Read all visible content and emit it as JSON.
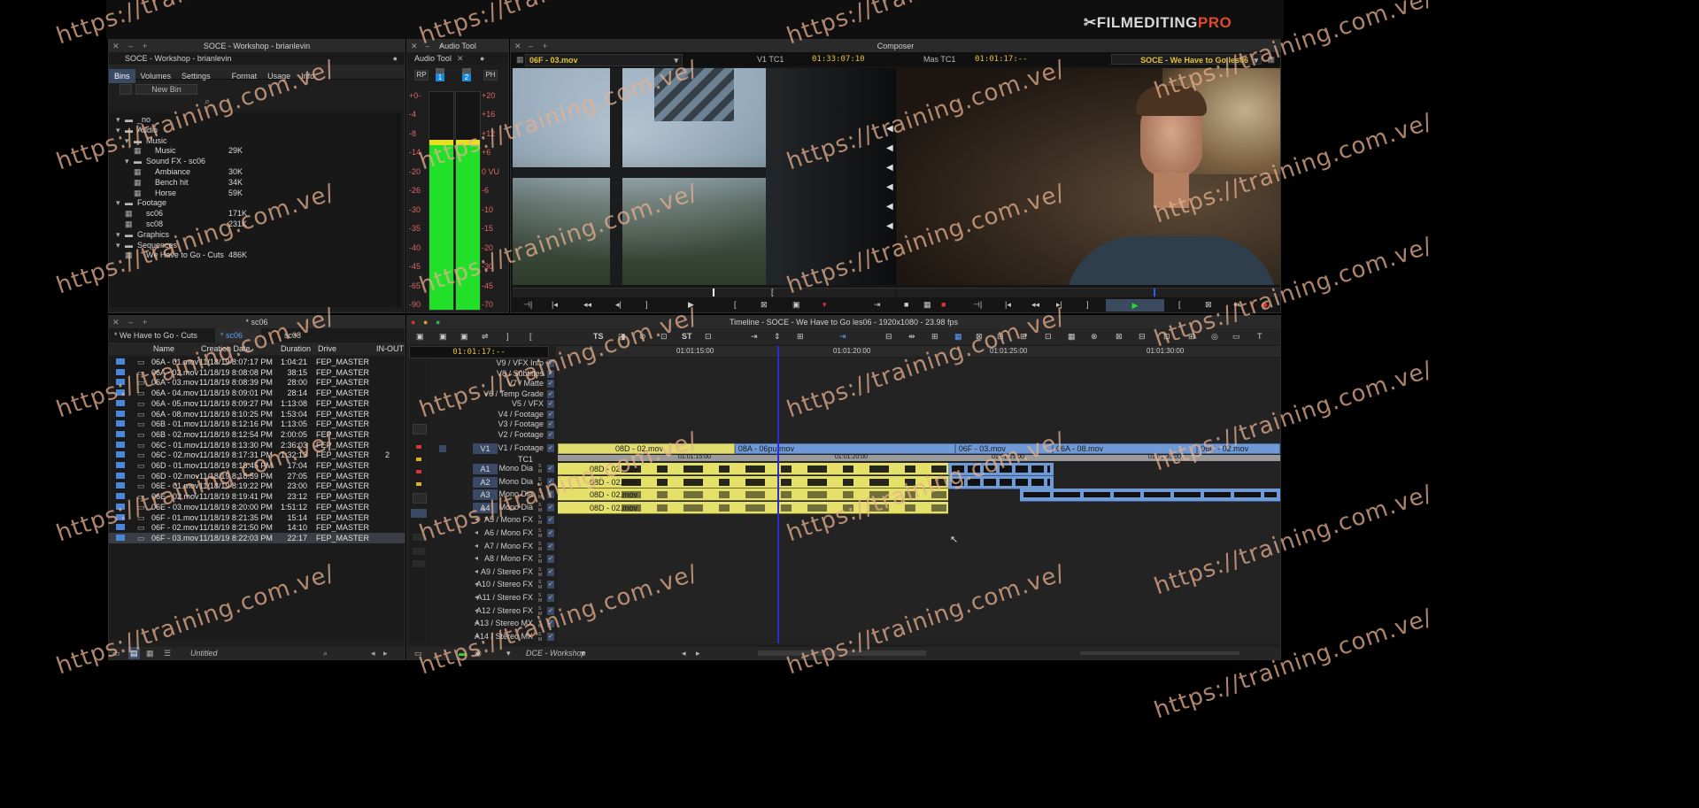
{
  "brand": {
    "logo_text": "FILMEDITING",
    "logo_accent": "PRO",
    "accent_color": "#e04a2a"
  },
  "project": {
    "title": "SOCE - Workshop - brianlevin",
    "subtitle": "SOCE - Workshop - brianlevin",
    "tabs": [
      "Bins",
      "Volumes",
      "Settings",
      "",
      "Format",
      "Usage",
      "Info"
    ],
    "new_bin_label": "New Bin",
    "tree": [
      {
        "label": "_no",
        "size": "",
        "indent": 0
      },
      {
        "label": "Audio",
        "size": "",
        "indent": 0
      },
      {
        "label": "Music",
        "size": "",
        "indent": 1
      },
      {
        "label": "Music",
        "size": "29K",
        "indent": 2
      },
      {
        "label": "Sound FX - sc06",
        "size": "",
        "indent": 1
      },
      {
        "label": "Ambiance",
        "size": "30K",
        "indent": 2
      },
      {
        "label": "Bench hit",
        "size": "34K",
        "indent": 2
      },
      {
        "label": "Horse",
        "size": "59K",
        "indent": 2
      },
      {
        "label": "Footage",
        "size": "",
        "indent": 0
      },
      {
        "label": "sc06",
        "size": "171K",
        "indent": 1
      },
      {
        "label": "sc08",
        "size": "231K",
        "indent": 1
      },
      {
        "label": "Graphics",
        "size": "",
        "indent": 0
      },
      {
        "label": "Sequences",
        "size": "",
        "indent": 0
      },
      {
        "label": "We Have to Go - Cuts",
        "size": "486K",
        "indent": 1
      }
    ]
  },
  "audio_tool": {
    "title": "Audio Tool",
    "tab": "Audio Tool",
    "rp_label": "RP",
    "ph_label": "PH",
    "ch1": "1",
    "ch2": "2",
    "left_scale": [
      "+0-",
      "-4",
      "-8",
      "-14",
      "-20",
      "-26",
      "-30",
      "-35",
      "-40",
      "-45",
      "-65",
      "-90"
    ],
    "right_scale": [
      "+20",
      "+16",
      "+12",
      "+6",
      "0 VU",
      "-6",
      "-10",
      "-15",
      "-20",
      "-30",
      "-45",
      "-70"
    ],
    "level_left": 0.78,
    "level_right": 0.78
  },
  "composer": {
    "title": "Composer",
    "source_clip": "06F - 03.mov",
    "v1_label": "V1  TC1",
    "v1_tc": "01:33:07:10",
    "mas_label": "Mas  TC1",
    "mas_tc": "01:01:17:--",
    "record_seq": "SOCE - We Have to Go les06"
  },
  "bin": {
    "title": "* sc06",
    "tabs": [
      "* We Have to Go - Cuts",
      "* sc06",
      "sc08"
    ],
    "columns": [
      "Name",
      "Creation Date",
      "Duration",
      "Drive",
      "IN-OUT"
    ],
    "rows": [
      {
        "name": "06A - 01.mov",
        "date": "11/18/19 8:07:17 PM",
        "dur": "1:04:21",
        "drive": "FEP_MASTER",
        "io": ""
      },
      {
        "name": "06A - 02.mov",
        "date": "11/18/19 8:08:08 PM",
        "dur": "38:15",
        "drive": "FEP_MASTER",
        "io": ""
      },
      {
        "name": "06A - 03.mov",
        "date": "11/18/19 8:08:39 PM",
        "dur": "28:00",
        "drive": "FEP_MASTER",
        "io": ""
      },
      {
        "name": "06A - 04.mov",
        "date": "11/18/19 8:09:01 PM",
        "dur": "28:14",
        "drive": "FEP_MASTER",
        "io": ""
      },
      {
        "name": "06A - 05.mov",
        "date": "11/18/19 8:09:27 PM",
        "dur": "1:13:08",
        "drive": "FEP_MASTER",
        "io": ""
      },
      {
        "name": "06A - 08.mov",
        "date": "11/18/19 8:10:25 PM",
        "dur": "1:53:04",
        "drive": "FEP_MASTER",
        "io": ""
      },
      {
        "name": "06B - 01.mov",
        "date": "11/18/19 8:12:16 PM",
        "dur": "1:13:05",
        "drive": "FEP_MASTER",
        "io": ""
      },
      {
        "name": "06B - 02.mov",
        "date": "11/18/19 8:12:54 PM",
        "dur": "2:00:05",
        "drive": "FEP_MASTER",
        "io": ""
      },
      {
        "name": "06C - 01.mov",
        "date": "11/18/19 8:13:30 PM",
        "dur": "2:36:03",
        "drive": "FEP_MASTER",
        "io": ""
      },
      {
        "name": "06C - 02.mov",
        "date": "11/18/19 8:17:31 PM",
        "dur": "1:32:13",
        "drive": "FEP_MASTER",
        "io": "2"
      },
      {
        "name": "06D - 01.mov",
        "date": "11/18/19 8:18:45 PM",
        "dur": "17:04",
        "drive": "FEP_MASTER",
        "io": ""
      },
      {
        "name": "06D - 02.mov",
        "date": "11/18/19 8:18:59 PM",
        "dur": "27:05",
        "drive": "FEP_MASTER",
        "io": ""
      },
      {
        "name": "06E - 01.mov",
        "date": "11/18/19 8:19:22 PM",
        "dur": "23:00",
        "drive": "FEP_MASTER",
        "io": ""
      },
      {
        "name": "06E - 02.mov",
        "date": "11/18/19 8:19:41 PM",
        "dur": "23:12",
        "drive": "FEP_MASTER",
        "io": ""
      },
      {
        "name": "06E - 03.mov",
        "date": "11/18/19 8:20:00 PM",
        "dur": "1:51:12",
        "drive": "FEP_MASTER",
        "io": ""
      },
      {
        "name": "06F - 01.mov",
        "date": "11/18/19 8:21:35 PM",
        "dur": "15:14",
        "drive": "FEP_MASTER",
        "io": ""
      },
      {
        "name": "06F - 02.mov",
        "date": "11/18/19 8:21:50 PM",
        "dur": "14:10",
        "drive": "FEP_MASTER",
        "io": ""
      },
      {
        "name": "06F - 03.mov",
        "date": "11/18/19 8:22:03 PM",
        "dur": "22:17",
        "drive": "FEP_MASTER",
        "io": ""
      }
    ],
    "footer_view": "Untitled"
  },
  "timeline": {
    "title": "Timeline - SOCE - We Have to Go les06 - 1920x1080 - 23.98 fps",
    "timecode": "01:01:17:--",
    "ruler": [
      "01:01:15:00",
      "01:01:20:00",
      "01:01:25:00",
      "01:01:30:00"
    ],
    "tc1_label": "TC1",
    "tracks": [
      "V9 / VFX Info",
      "V8 / Subtitles",
      "V7 / Matte",
      "V6 / Temp Grade",
      "V5 / VFX",
      "V4 / Footage",
      "V3 / Footage",
      "V2 / Footage",
      "V1 / Footage",
      "A1 / Mono Dia",
      "A2 / Mono Dia",
      "A3 / Mono Dia",
      "A4 / Mono Dia",
      "A5 / Mono FX",
      "A6 / Mono FX",
      "A7 / Mono FX",
      "A8 / Mono FX",
      "A9 / Stereo FX",
      "A10 / Stereo FX",
      "A11 / Stereo FX",
      "A12 / Stereo FX",
      "A13 / Stereo MX",
      "A14 / Stereo MX"
    ],
    "v1_patch": "V1",
    "a_patches": [
      "A1",
      "A2",
      "A3",
      "A4"
    ],
    "video_clips": [
      "08D - 02.mov",
      "08A - 06pu.mov",
      "06F - 03.mov",
      "06A - 08.mov",
      "06C - 02.mov"
    ],
    "video_tcs": [
      "01:01:15:00",
      "01:01:20:00",
      "01:01:25:00",
      "01:01:30:00"
    ],
    "audio_clips": [
      "08D - 02.mov",
      "08D - 02.mov",
      "08D - 02.mov",
      "08D - 02.mov"
    ],
    "toolbar_ts": "TS",
    "toolbar_st": "ST",
    "project_footer": "DCE - Workshop"
  },
  "watermark": "https://training.com.ve/"
}
